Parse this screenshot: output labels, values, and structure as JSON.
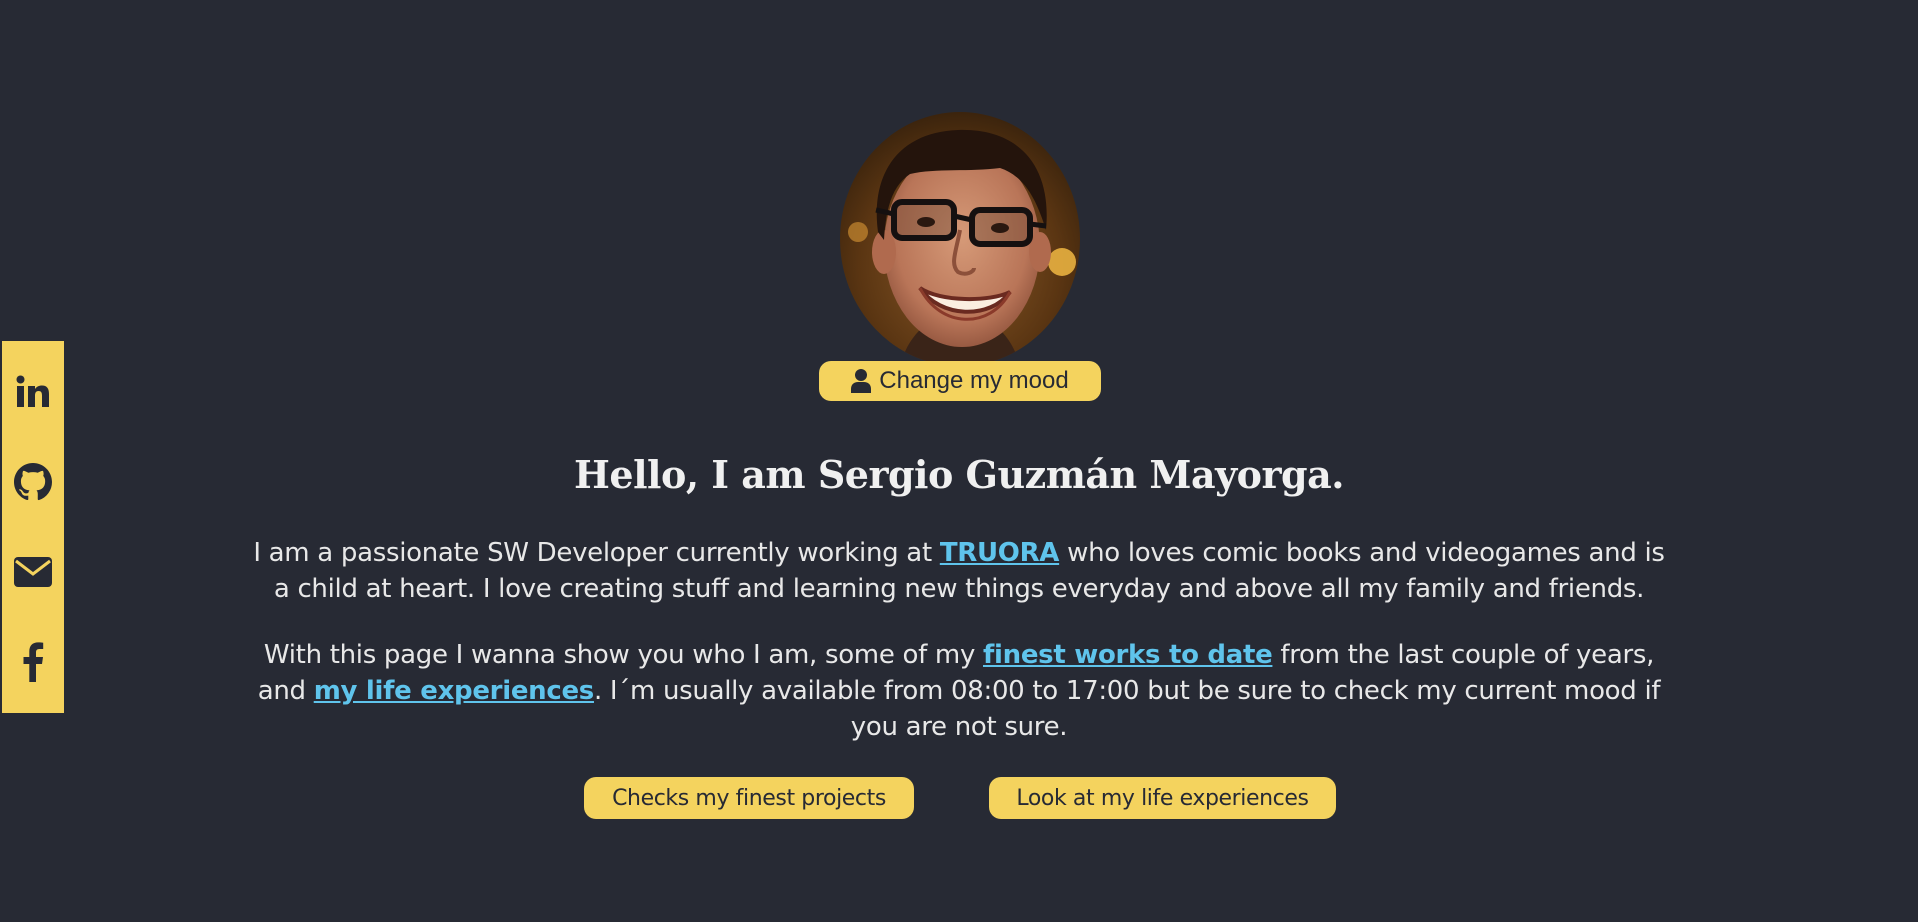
{
  "colors": {
    "background": "#272a34",
    "accent": "#f4d35e",
    "link": "#5fc4ec",
    "text": "#e8e8e8"
  },
  "social": {
    "items": [
      {
        "name": "linkedin",
        "icon": "linkedin-icon"
      },
      {
        "name": "github",
        "icon": "github-icon"
      },
      {
        "name": "email",
        "icon": "envelope-icon"
      },
      {
        "name": "facebook",
        "icon": "facebook-icon"
      }
    ]
  },
  "profile": {
    "mood_button_label": "Change my mood",
    "mood_button_icon": "user-icon"
  },
  "hero": {
    "title": "Hello, I am Sergio Guzmán Mayorga."
  },
  "intro": {
    "p1_before": "I am a passionate SW Developer currently working at ",
    "p1_link": "TRUORA",
    "p1_after": " who loves comic books and videogames and is a child at heart. I love creating stuff and learning new things everyday and above all my family and friends.",
    "p2_before": "With this page I wanna show you who I am, some of my ",
    "p2_link1": "finest works to date",
    "p2_middle": " from the last couple of years, and ",
    "p2_link2": "my life experiences",
    "p2_after": ". I´m usually available from 08:00 to 17:00 but be sure to check my current mood if you are not sure."
  },
  "actions": {
    "projects_label": "Checks my finest projects",
    "experiences_label": "Look at my life experiences"
  }
}
